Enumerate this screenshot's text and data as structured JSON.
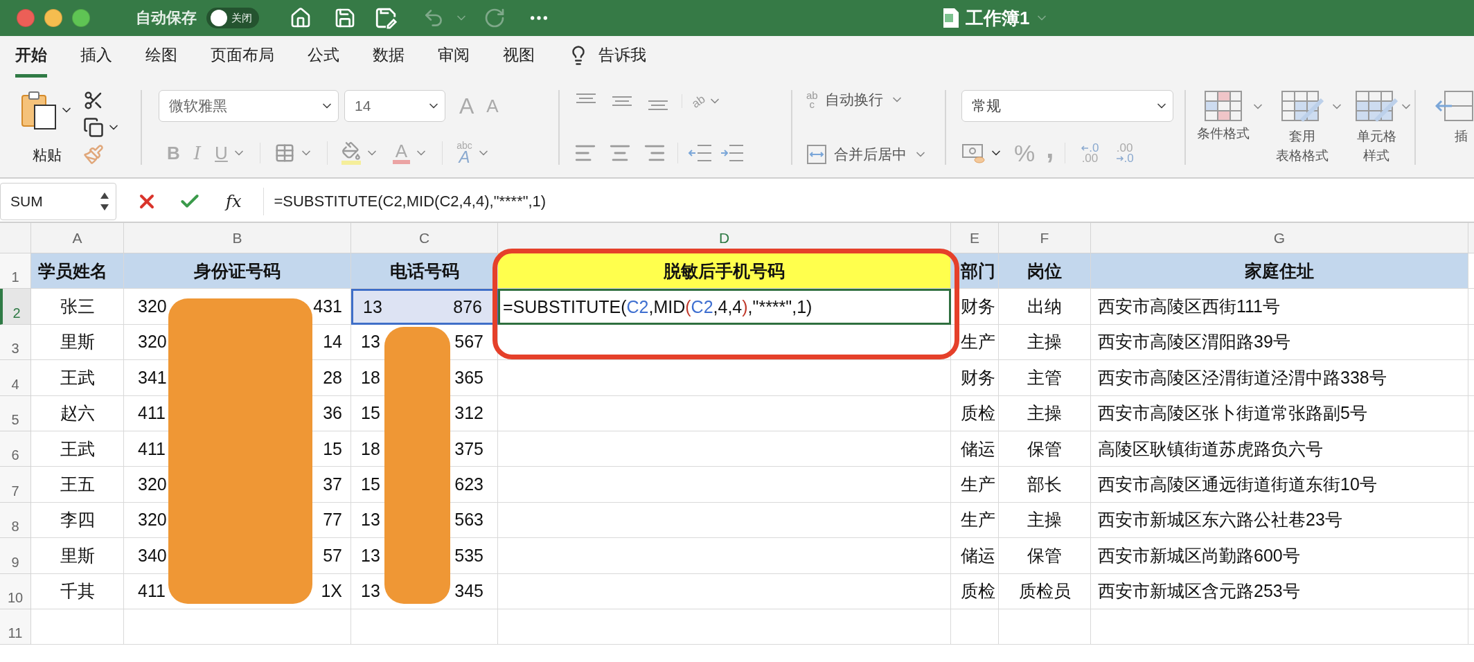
{
  "title_bar": {
    "autosave_label": "自动保存",
    "autosave_toggle": {
      "label": "关闭",
      "on": false
    },
    "document_title": "工作簿1"
  },
  "menu_tabs": [
    {
      "label": "开始",
      "selected": true
    },
    {
      "label": "插入",
      "selected": false
    },
    {
      "label": "绘图",
      "selected": false
    },
    {
      "label": "页面布局",
      "selected": false
    },
    {
      "label": "公式",
      "selected": false
    },
    {
      "label": "数据",
      "selected": false
    },
    {
      "label": "审阅",
      "selected": false
    },
    {
      "label": "视图",
      "selected": false
    }
  ],
  "tell_me": "告诉我",
  "ribbon": {
    "paste_label": "粘贴",
    "font_name": "微软雅黑",
    "font_size": "14",
    "grow_glyph": "A",
    "shrink_glyph": "A",
    "bold_glyph": "B",
    "italic_glyph": "I",
    "underline_glyph": "U",
    "font_color_glyph": "A",
    "text_effect_glyphs": [
      "abc",
      "A"
    ],
    "orientation_glyph": "ab",
    "wrap_glyphs": [
      "ab",
      "c"
    ],
    "wrap_text": "自动换行",
    "merge_center": "合并后居中",
    "number_format": "常规",
    "percent_glyph": "%",
    "comma_glyph": ",",
    "increase_decimal_glyphs": [
      ".0",
      ".00"
    ],
    "decrease_decimal_glyphs": [
      ".00",
      ".0"
    ],
    "styles": [
      {
        "lines": [
          "条件格式"
        ],
        "kind": "conditional"
      },
      {
        "lines": [
          "套用",
          "表格格式"
        ],
        "kind": "table"
      },
      {
        "lines": [
          "单元格",
          "样式"
        ],
        "kind": "cell"
      }
    ],
    "insert_label": "插"
  },
  "formula_bar": {
    "name_box": "SUM",
    "fx_glyph": "fx",
    "formula": "=SUBSTITUTE(C2,MID(C2,4,4),\"****\",1)"
  },
  "columns": [
    {
      "letter": "A",
      "selected": false
    },
    {
      "letter": "B",
      "selected": false
    },
    {
      "letter": "C",
      "selected": false
    },
    {
      "letter": "D",
      "selected": true
    },
    {
      "letter": "E",
      "selected": false
    },
    {
      "letter": "F",
      "selected": false
    },
    {
      "letter": "G",
      "selected": false
    }
  ],
  "header_row": {
    "number": "1",
    "cells": [
      {
        "text": "学员姓名",
        "highlighted": false
      },
      {
        "text": "身份证号码",
        "highlighted": false
      },
      {
        "text": "电话号码",
        "highlighted": false
      },
      {
        "text": "脱敏后手机号码",
        "highlighted": true
      },
      {
        "text": "部门",
        "highlighted": false
      },
      {
        "text": "岗位",
        "highlighted": false
      },
      {
        "text": "家庭住址",
        "highlighted": false
      }
    ]
  },
  "rows": [
    {
      "number": "2",
      "selected": true,
      "name": "张三",
      "id_start": "320",
      "id_end": "431",
      "phone_start": "13",
      "phone_end": "876",
      "dept": "财务",
      "role": "出纳",
      "address": "西安市高陵区西街111号",
      "formula_parts": [
        {
          "text": "=SUBSTITUTE(",
          "kind": "plain"
        },
        {
          "text": "C2",
          "kind": "ref"
        },
        {
          "text": ",MID",
          "kind": "plain"
        },
        {
          "text": "(",
          "kind": "paren"
        },
        {
          "text": "C2",
          "kind": "ref"
        },
        {
          "text": ",4,4",
          "kind": "plain"
        },
        {
          "text": ")",
          "kind": "paren"
        },
        {
          "text": ",\"****\",1)",
          "kind": "plain"
        }
      ]
    },
    {
      "number": "3",
      "selected": false,
      "name": "里斯",
      "id_start": "320",
      "id_end": "14",
      "phone_start": "13",
      "phone_end": "567",
      "dept": "生产",
      "role": "主操",
      "address": "西安市高陵区渭阳路39号"
    },
    {
      "number": "4",
      "selected": false,
      "name": "王武",
      "id_start": "341",
      "id_end": "28",
      "phone_start": "18",
      "phone_end": "365",
      "dept": "财务",
      "role": "主管",
      "address": "西安市高陵区泾渭街道泾渭中路338号"
    },
    {
      "number": "5",
      "selected": false,
      "name": "赵六",
      "id_start": "411",
      "id_end": "36",
      "phone_start": "15",
      "phone_end": "312",
      "dept": "质检",
      "role": "主操",
      "address": "西安市高陵区张卜街道常张路副5号"
    },
    {
      "number": "6",
      "selected": false,
      "name": "王武",
      "id_start": "411",
      "id_end": "15",
      "phone_start": "18",
      "phone_end": "375",
      "dept": "储运",
      "role": "保管",
      "address": "高陵区耿镇街道苏虎路负六号"
    },
    {
      "number": "7",
      "selected": false,
      "name": "王五",
      "id_start": "320",
      "id_end": "37",
      "phone_start": "15",
      "phone_end": "623",
      "dept": "生产",
      "role": "部长",
      "address": "西安市高陵区通远街道街道东街10号"
    },
    {
      "number": "8",
      "selected": false,
      "name": "李四",
      "id_start": "320",
      "id_end": "77",
      "phone_start": "13",
      "phone_end": "563",
      "dept": "生产",
      "role": "主操",
      "address": "西安市新城区东六路公社巷23号"
    },
    {
      "number": "9",
      "selected": false,
      "name": "里斯",
      "id_start": "340",
      "id_end": "57",
      "phone_start": "13",
      "phone_end": "535",
      "dept": "储运",
      "role": "保管",
      "address": "西安市新城区尚勤路600号"
    },
    {
      "number": "10",
      "selected": false,
      "name": "千其",
      "id_start": "411",
      "id_end": "1X",
      "phone_start": "13",
      "phone_end": "345",
      "dept": "质检",
      "role": "质检员",
      "address": "西安市新城区含元路253号"
    },
    {
      "number": "11",
      "selected": false
    }
  ]
}
